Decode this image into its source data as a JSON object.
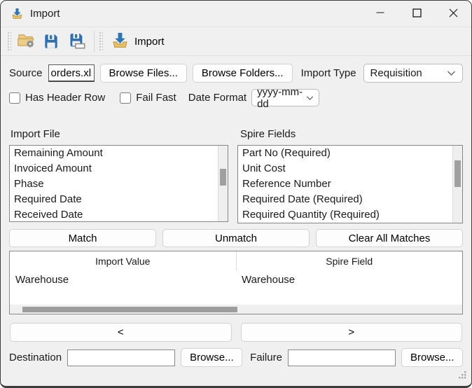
{
  "window": {
    "title": "Import",
    "controls": {
      "minimize": "minimize",
      "maximize": "maximize",
      "close": "close"
    }
  },
  "toolbar": {
    "import_label": "Import"
  },
  "source_row": {
    "source_label": "Source",
    "source_value": "orders.xlsx",
    "browse_files_label": "Browse Files...",
    "browse_folders_label": "Browse Folders...",
    "import_type_label": "Import Type",
    "import_type_value": "Requisition"
  },
  "options_row": {
    "has_header_row_label": "Has Header Row",
    "has_header_row_checked": false,
    "fail_fast_label": "Fail Fast",
    "fail_fast_checked": false,
    "date_format_label": "Date Format",
    "date_format_value": "yyyy-mm-dd"
  },
  "import_file_list": {
    "label": "Import File",
    "items": [
      "Remaining Amount",
      "Invoiced Amount",
      "Phase",
      "Required Date",
      "Received Date"
    ]
  },
  "spire_fields_list": {
    "label": "Spire Fields",
    "items": [
      "Part No (Required)",
      "Unit Cost",
      "Reference Number",
      "Required Date (Required)",
      "Required Quantity (Required)"
    ]
  },
  "match_buttons": {
    "match": "Match",
    "unmatch": "Unmatch",
    "clear_all": "Clear All Matches"
  },
  "mapping_table": {
    "columns": [
      "Import Value",
      "Spire Field"
    ],
    "rows": [
      [
        "Warehouse",
        "Warehouse"
      ]
    ]
  },
  "move_buttons": {
    "left": "<",
    "right": ">"
  },
  "destination_row": {
    "destination_label": "Destination",
    "destination_value": "",
    "destination_browse_label": "Browse...",
    "failure_label": "Failure",
    "failure_value": "",
    "failure_browse_label": "Browse..."
  },
  "icons": {
    "app-import-icon": "tray-with-down-arrow",
    "open-settings-icon": "folder-with-gear",
    "save-icon": "floppy-disk",
    "save-as-icon": "floppy-disk-with-label",
    "toolbar-import-icon": "tray-with-down-arrow",
    "chevron-down-icon": "v-chevron",
    "minimize-icon": "horizontal-line",
    "maximize-icon": "square-outline",
    "close-icon": "x-cross",
    "resize-grip-icon": "dot-triangle"
  },
  "colors": {
    "accent_blue": "#2e75b6",
    "icon_tan": "#e8c06a",
    "window_bg": "#f0f0f0",
    "window_border": "#3c3c3c",
    "scrollbar_thumb": "#a0a0a0"
  }
}
